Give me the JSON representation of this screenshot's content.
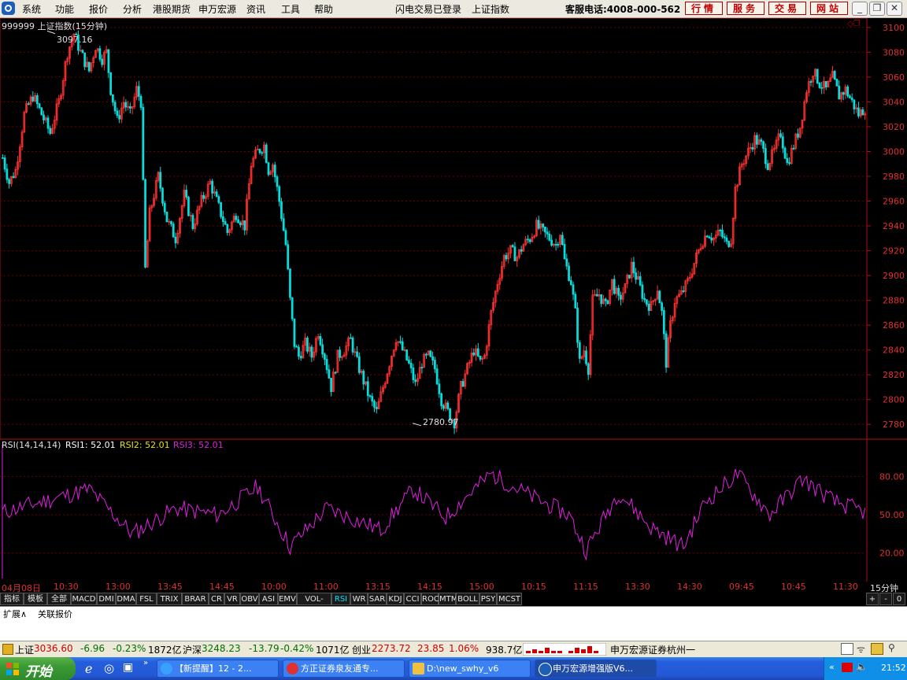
{
  "menu": {
    "items": [
      "系统",
      "功能",
      "报价",
      "分析",
      "港股期货",
      "申万宏源",
      "资讯",
      "工具",
      "帮助"
    ],
    "notice1": "闪电交易已登录",
    "notice2": "上证指数",
    "hotline": "客服电话:4008-000-562",
    "buttons": [
      "行情",
      "服务",
      "交易",
      "网站"
    ]
  },
  "chart": {
    "title": "999999 上证指数(15分钟)",
    "high_label": "3097.16",
    "low_label": "2780.97",
    "price_ticks": [
      "3100",
      "3080",
      "3060",
      "3040",
      "3020",
      "3000",
      "2980",
      "2960",
      "2940",
      "2920",
      "2900",
      "2880",
      "2860",
      "2840",
      "2820",
      "2800",
      "2780"
    ],
    "rsi_header": {
      "name": "RSI(14,14,14)",
      "rsi1": "RSI1: 52.01",
      "rsi2": "RSI2: 52.01",
      "rsi3": "RSI3: 52.01"
    },
    "rsi_ticks": [
      "80.00",
      "50.00",
      "20.00"
    ],
    "time_labels": [
      "04月08日",
      "10:30",
      "13:00",
      "13:45",
      "14:45",
      "10:00",
      "11:00",
      "13:15",
      "14:15",
      "15:00",
      "10:15",
      "11:15",
      "13:30",
      "14:30",
      "09:45",
      "10:45",
      "11:30"
    ],
    "period": "15分钟",
    "colors": {
      "up": "#ff3030",
      "down": "#00e0e0",
      "rsi": "#e020e0",
      "axis": "#b01010"
    }
  },
  "chart_data": {
    "type": "candlestick",
    "title": "999999 上证指数(15分钟)",
    "ylim": [
      2770,
      3105
    ],
    "annotations": [
      {
        "label": "3097.16",
        "value": 3097.16
      },
      {
        "label": "2780.97",
        "value": 2780.97
      }
    ],
    "price_path": [
      [
        0,
        2995
      ],
      [
        3,
        2975
      ],
      [
        6,
        2985
      ],
      [
        10,
        3030
      ],
      [
        14,
        3045
      ],
      [
        18,
        3030
      ],
      [
        22,
        3015
      ],
      [
        26,
        3040
      ],
      [
        30,
        3080
      ],
      [
        33,
        3095
      ],
      [
        36,
        3080
      ],
      [
        40,
        3065
      ],
      [
        43,
        3085
      ],
      [
        46,
        3075
      ],
      [
        48,
        3080
      ],
      [
        50,
        3050
      ],
      [
        53,
        3025
      ],
      [
        56,
        3040
      ],
      [
        59,
        3030
      ],
      [
        62,
        3050
      ],
      [
        64,
        3040
      ],
      [
        66,
        2905
      ],
      [
        68,
        2950
      ],
      [
        72,
        2980
      ],
      [
        76,
        2945
      ],
      [
        80,
        2930
      ],
      [
        84,
        2965
      ],
      [
        88,
        2940
      ],
      [
        92,
        2960
      ],
      [
        96,
        2975
      ],
      [
        100,
        2955
      ],
      [
        104,
        2935
      ],
      [
        108,
        2950
      ],
      [
        112,
        2940
      ],
      [
        115,
        2990
      ],
      [
        118,
        3000
      ],
      [
        121,
        3005
      ],
      [
        123,
        2985
      ],
      [
        125,
        2990
      ],
      [
        128,
        2960
      ],
      [
        131,
        2925
      ],
      [
        133,
        2880
      ],
      [
        135,
        2845
      ],
      [
        137,
        2835
      ],
      [
        140,
        2845
      ],
      [
        143,
        2835
      ],
      [
        146,
        2855
      ],
      [
        149,
        2835
      ],
      [
        152,
        2810
      ],
      [
        155,
        2835
      ],
      [
        158,
        2840
      ],
      [
        161,
        2848
      ],
      [
        164,
        2830
      ],
      [
        167,
        2815
      ],
      [
        170,
        2800
      ],
      [
        173,
        2790
      ],
      [
        176,
        2810
      ],
      [
        179,
        2830
      ],
      [
        182,
        2850
      ],
      [
        185,
        2840
      ],
      [
        188,
        2828
      ],
      [
        191,
        2812
      ],
      [
        194,
        2830
      ],
      [
        197,
        2835
      ],
      [
        200,
        2825
      ],
      [
        203,
        2800
      ],
      [
        206,
        2790
      ],
      [
        209,
        2782
      ],
      [
        212,
        2810
      ],
      [
        215,
        2825
      ],
      [
        218,
        2840
      ],
      [
        221,
        2830
      ],
      [
        223,
        2835
      ],
      [
        226,
        2870
      ],
      [
        229,
        2895
      ],
      [
        232,
        2915
      ],
      [
        235,
        2920
      ],
      [
        238,
        2915
      ],
      [
        241,
        2925
      ],
      [
        244,
        2930
      ],
      [
        247,
        2940
      ],
      [
        250,
        2935
      ],
      [
        253,
        2930
      ],
      [
        256,
        2925
      ],
      [
        258,
        2935
      ],
      [
        260,
        2912
      ],
      [
        263,
        2895
      ],
      [
        265,
        2870
      ],
      [
        267,
        2830
      ],
      [
        269,
        2840
      ],
      [
        271,
        2825
      ],
      [
        273,
        2880
      ],
      [
        276,
        2885
      ],
      [
        279,
        2875
      ],
      [
        282,
        2895
      ],
      [
        285,
        2880
      ],
      [
        288,
        2890
      ],
      [
        291,
        2908
      ],
      [
        294,
        2895
      ],
      [
        297,
        2880
      ],
      [
        300,
        2875
      ],
      [
        303,
        2890
      ],
      [
        305,
        2870
      ],
      [
        307,
        2830
      ],
      [
        309,
        2860
      ],
      [
        311,
        2880
      ],
      [
        314,
        2885
      ],
      [
        317,
        2895
      ],
      [
        320,
        2910
      ],
      [
        323,
        2925
      ],
      [
        326,
        2935
      ],
      [
        329,
        2930
      ],
      [
        332,
        2935
      ],
      [
        335,
        2925
      ],
      [
        337,
        2930
      ],
      [
        339,
        2970
      ],
      [
        342,
        2990
      ],
      [
        345,
        3000
      ],
      [
        348,
        3010
      ],
      [
        351,
        3005
      ],
      [
        354,
        2990
      ],
      [
        357,
        3000
      ],
      [
        360,
        3015
      ],
      [
        363,
        2990
      ],
      [
        366,
        3005
      ],
      [
        369,
        3020
      ],
      [
        372,
        3050
      ],
      [
        375,
        3065
      ],
      [
        378,
        3055
      ],
      [
        381,
        3050
      ],
      [
        384,
        3060
      ],
      [
        387,
        3045
      ],
      [
        390,
        3050
      ],
      [
        393,
        3040
      ],
      [
        396,
        3030
      ],
      [
        399,
        3035
      ]
    ],
    "rsi": [
      [
        0,
        52
      ],
      [
        40,
        70
      ],
      [
        60,
        35
      ],
      [
        80,
        55
      ],
      [
        100,
        50
      ],
      [
        118,
        72
      ],
      [
        133,
        25
      ],
      [
        150,
        55
      ],
      [
        175,
        38
      ],
      [
        190,
        70
      ],
      [
        205,
        48
      ],
      [
        215,
        65
      ],
      [
        226,
        82
      ],
      [
        245,
        64
      ],
      [
        262,
        50
      ],
      [
        270,
        22
      ],
      [
        285,
        68
      ],
      [
        300,
        40
      ],
      [
        315,
        25
      ],
      [
        325,
        60
      ],
      [
        340,
        82
      ],
      [
        355,
        50
      ],
      [
        370,
        78
      ],
      [
        385,
        60
      ],
      [
        399,
        52
      ]
    ]
  },
  "indicator_tabs": [
    "指标",
    "模板",
    "全部",
    "MACD",
    "DMI",
    "DMA",
    "FSL",
    "TRIX",
    "BRAR",
    "CR",
    "VR",
    "OBV",
    "ASI",
    "EMV",
    "VOL-TDX",
    "RSI",
    "WR",
    "SAR",
    "KDJ",
    "CCI",
    "ROC",
    "MTM",
    "BOLL",
    "PSY",
    "MCST"
  ],
  "active_tab": "RSI",
  "zoom_controls": [
    "+",
    "-",
    "0"
  ],
  "expand": {
    "label1": "扩展∧",
    "label2": "关联报价"
  },
  "status": {
    "sh_name": "上证",
    "sh_val": "3036.60",
    "sh_chg": "-6.96",
    "sh_pct": "-0.23%",
    "sh_amt": "1872亿",
    "hs_name": "沪深",
    "hs_val": "3248.23",
    "hs_chg": "-13.79",
    "hs_pct": "-0.42%",
    "hs_amt": "1071亿",
    "cy_name": "创业",
    "cy_val": "2273.72",
    "cy_chg": "23.85",
    "cy_pct": "1.06%",
    "cy_amt": "938.7亿",
    "broker": "申万宏源证券杭州一"
  },
  "taskbar": {
    "start": "开始",
    "tasks": [
      "【新提醒】12 - 2...",
      "方正证券泉友通专...",
      "D:\\new_swhy_v6",
      "申万宏源增强版V6..."
    ],
    "time": "21:52"
  }
}
